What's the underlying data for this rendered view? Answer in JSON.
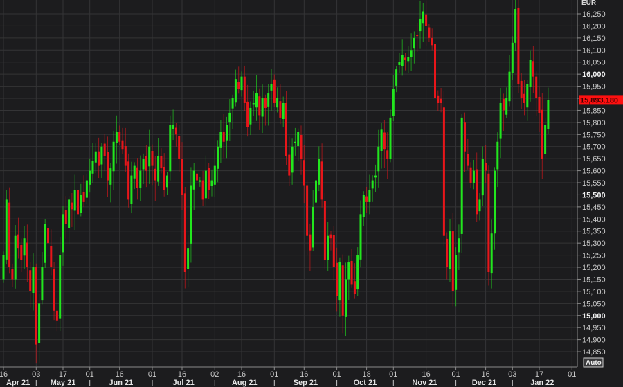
{
  "chart_data": {
    "type": "candlestick",
    "title": "",
    "currency_label": "EUR",
    "auto_label": "Auto",
    "last_price_label": "15,893.180",
    "last_price": 15893.18,
    "ylim": [
      14820,
      16290
    ],
    "grid": true,
    "y_ticks": [
      14850,
      14900,
      14950,
      15000,
      15050,
      15100,
      15150,
      15200,
      15250,
      15300,
      15350,
      15400,
      15450,
      15500,
      15550,
      15600,
      15650,
      15700,
      15750,
      15800,
      15850,
      15900,
      15950,
      16000,
      16050,
      16100,
      16150,
      16200,
      16250
    ],
    "y_tick_labels": [
      "14,850",
      "14,900",
      "14,950",
      "15,000",
      "15,050",
      "15,100",
      "15,150",
      "15,200",
      "15,250",
      "15,300",
      "15,350",
      "15,400",
      "15,450",
      "15,500",
      "15,550",
      "15,600",
      "15,650",
      "15,700",
      "15,750",
      "15,800",
      "15,850",
      "15,900",
      "15,950",
      "16,000",
      "16,050",
      "16,100",
      "16,150",
      "16,200",
      "16,250"
    ],
    "y_major_ticks": [
      15000,
      15500,
      16000
    ],
    "x_day_ticks": [
      {
        "label": "16",
        "index": 0
      },
      {
        "label": "03",
        "index": 11
      },
      {
        "label": "17",
        "index": 20
      },
      {
        "label": "01",
        "index": 29
      },
      {
        "label": "16",
        "index": 39
      },
      {
        "label": "01",
        "index": 50
      },
      {
        "label": "16",
        "index": 60
      },
      {
        "label": "02",
        "index": 71
      },
      {
        "label": "16",
        "index": 80
      },
      {
        "label": "01",
        "index": 91
      },
      {
        "label": "16",
        "index": 101
      },
      {
        "label": "01",
        "index": 112
      },
      {
        "label": "18",
        "index": 122
      },
      {
        "label": "01",
        "index": 131
      },
      {
        "label": "16",
        "index": 142
      },
      {
        "label": "01",
        "index": 152
      },
      {
        "label": "16",
        "index": 162
      },
      {
        "label": "03",
        "index": 171
      },
      {
        "label": "17",
        "index": 180
      },
      {
        "label": "01",
        "index": 191
      }
    ],
    "x_months": [
      {
        "label": "Apr 21",
        "from": -2,
        "to": 11
      },
      {
        "label": "May 21",
        "from": 11,
        "to": 29
      },
      {
        "label": "Jun 21",
        "from": 29,
        "to": 50
      },
      {
        "label": "Jul 21",
        "from": 50,
        "to": 71
      },
      {
        "label": "Aug 21",
        "from": 71,
        "to": 91
      },
      {
        "label": "Sep 21",
        "from": 91,
        "to": 112
      },
      {
        "label": "Oct 21",
        "from": 112,
        "to": 131
      },
      {
        "label": "Nov 21",
        "from": 131,
        "to": 152
      },
      {
        "label": "Dec 21",
        "from": 152,
        "to": 171
      },
      {
        "label": "Jan 22",
        "from": 171,
        "to": 191
      }
    ],
    "first_open": 15150,
    "close": [
      15250,
      15480,
      15200,
      15150,
      15330,
      15280,
      15230,
      15320,
      15200,
      15100,
      15200,
      14880,
      15050,
      15200,
      15380,
      15300,
      15200,
      15020,
      14980,
      15250,
      15420,
      15380,
      15480,
      15440,
      15520,
      15420,
      15500,
      15470,
      15560,
      15600,
      15640,
      15680,
      15620,
      15700,
      15660,
      15560,
      15610,
      15720,
      15760,
      15720,
      15690,
      15620,
      15480,
      15580,
      15620,
      15530,
      15600,
      15650,
      15600,
      15700,
      15620,
      15560,
      15660,
      15610,
      15520,
      15580,
      15790,
      15790,
      15750,
      15650,
      15500,
      15180,
      15280,
      15540,
      15600,
      15560,
      15560,
      15480,
      15600,
      15520,
      15560,
      15620,
      15700,
      15760,
      15720,
      15790,
      15840,
      15900,
      15980,
      15940,
      15990,
      15880,
      15780,
      15860,
      15880,
      15920,
      15830,
      15900,
      15860,
      15920,
      15960,
      15880,
      15900,
      15820,
      15880,
      15660,
      15580,
      15700,
      15720,
      15760,
      15650,
      15540,
      15330,
      15270,
      15450,
      15560,
      15650,
      15480,
      15230,
      15330,
      15320,
      15200,
      15080,
      15220,
      15000,
      15150,
      15220,
      15130,
      15090,
      15250,
      15420,
      15500,
      15470,
      15520,
      15560,
      15580,
      15700,
      15770,
      15690,
      15650,
      15820,
      15940,
      16020,
      16050,
      16080,
      16060,
      16070,
      16100,
      16150,
      16160,
      16230,
      16260,
      16200,
      16150,
      16120,
      15900,
      15880,
      15880,
      15330,
      15200,
      15350,
      15100,
      15250,
      15320,
      15820,
      15680,
      15620,
      15550,
      15600,
      15420,
      15480,
      15650,
      15600,
      15180,
      15340,
      15600,
      15720,
      15880,
      15850,
      15900,
      16010,
      16130,
      16270,
      15960,
      15900,
      15880,
      15960,
      16060,
      15990,
      15900,
      15840,
      15650,
      15790,
      15893.18
    ],
    "colors": {
      "up": "#22e61e",
      "down": "#e8161a",
      "background": "#1c1c1e",
      "grid": "#343436",
      "price_tag": "#ff1010"
    }
  }
}
